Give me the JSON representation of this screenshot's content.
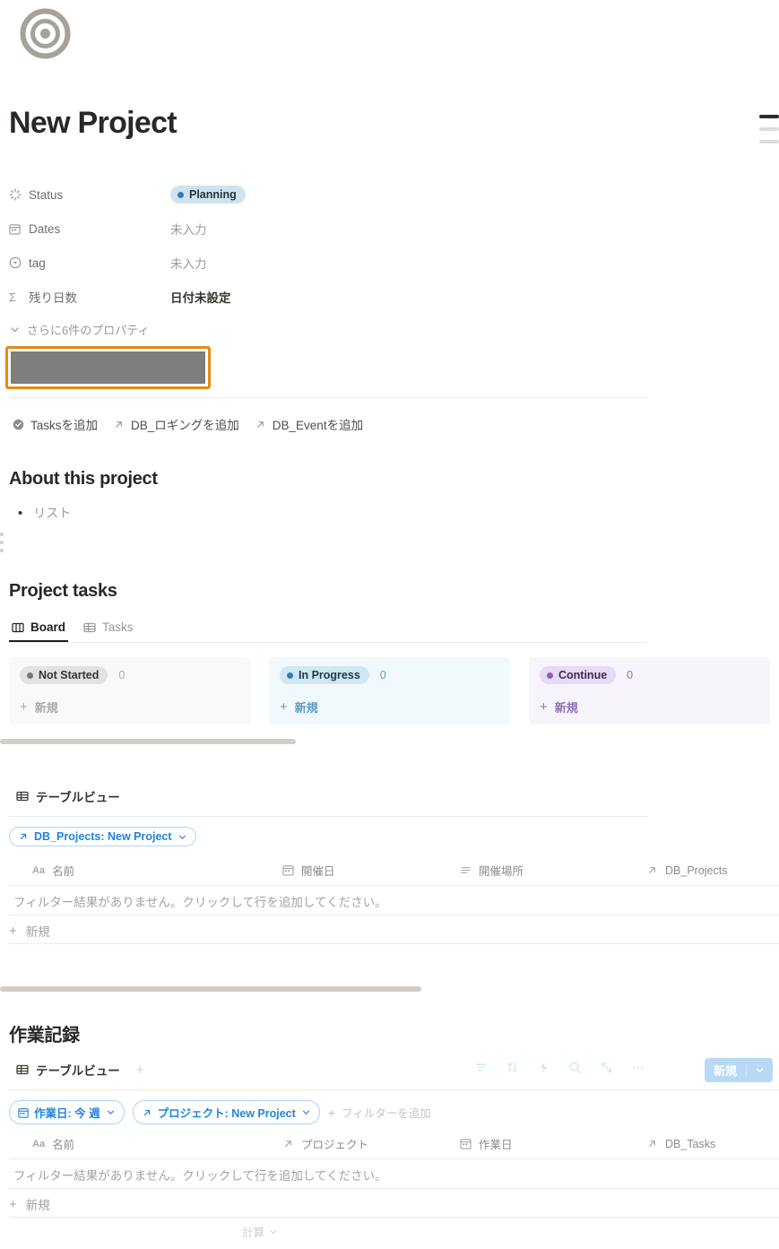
{
  "header": {
    "icon": "target-icon",
    "title": "New Project"
  },
  "properties": {
    "rows": [
      {
        "icon": "spinner-icon",
        "label": "Status",
        "value": "Planning",
        "type": "status-pill"
      },
      {
        "icon": "calendar-icon",
        "label": "Dates",
        "value": "未入力",
        "type": "empty"
      },
      {
        "icon": "select-icon",
        "label": "tag",
        "value": "未入力",
        "type": "empty"
      },
      {
        "icon": "sigma-icon",
        "label": "残り日数",
        "value": "日付未設定",
        "type": "formula"
      }
    ],
    "more_label": "さらに6件のプロパティ",
    "status_pill_bg": "#cfe3ef",
    "status_pill_dot": "#3a7ca8"
  },
  "redacted_block": {
    "highlight_color": "#e08c13",
    "fill_color": "#7e7e7e"
  },
  "add_buttons": [
    {
      "icon": "check-circle-icon",
      "label": "Tasksを追加"
    },
    {
      "icon": "arrow-up-right-icon",
      "label": "DB_ロギングを追加"
    },
    {
      "icon": "arrow-up-right-icon",
      "label": "DB_Eventを追加"
    }
  ],
  "about": {
    "heading": "About this project",
    "bullet": "リスト"
  },
  "project_tasks": {
    "heading": "Project tasks",
    "tabs": [
      {
        "label": "Board",
        "icon": "board-icon",
        "active": true
      },
      {
        "label": "Tasks",
        "icon": "table-icon",
        "active": false
      }
    ],
    "columns": [
      {
        "label": "Not Started",
        "count": "0",
        "new_label": "新規",
        "accent": "#7a7874"
      },
      {
        "label": "In Progress",
        "count": "0",
        "new_label": "新規",
        "accent": "#2f80b8"
      },
      {
        "label": "Continue",
        "count": "0",
        "new_label": "新規",
        "accent": "#8b5fc0"
      },
      {
        "label": "",
        "count": "",
        "new_label": "",
        "accent": "#be7249"
      }
    ]
  },
  "table_view_1": {
    "view_label": "テーブルビュー",
    "filter_chip": "DB_Projects: New Project",
    "columns": [
      {
        "icon": "title-icon",
        "label": "名前"
      },
      {
        "icon": "calendar-icon",
        "label": "開催日"
      },
      {
        "icon": "text-icon",
        "label": "開催場所"
      },
      {
        "icon": "arrow-up-right-icon",
        "label": "DB_Projects"
      }
    ],
    "empty_message": "フィルター結果がありません。クリックして行を追加してください。",
    "new_row_label": "新規"
  },
  "work_log": {
    "heading": "作業記録",
    "view_label": "テーブルビュー",
    "toolbar_icons": [
      "filter-icon",
      "sort-icon",
      "automation-icon",
      "search-icon",
      "expand-icon",
      "more-icon"
    ],
    "new_button_label": "新規",
    "filter_chips": [
      {
        "icon": "calendar-icon",
        "label": "作業日: 今 週"
      },
      {
        "icon": "arrow-up-right-icon",
        "label": "プロジェクト: New Project"
      }
    ],
    "add_filter_label": "フィルターを追加",
    "columns": [
      {
        "icon": "title-icon",
        "label": "名前"
      },
      {
        "icon": "arrow-up-right-icon",
        "label": "プロジェクト"
      },
      {
        "icon": "calendar-icon",
        "label": "作業日"
      },
      {
        "icon": "arrow-up-right-icon",
        "label": "DB_Tasks"
      }
    ],
    "empty_message": "フィルター結果がありません。クリックして行を追加してください。",
    "new_row_label": "新規",
    "calculate_label": "計算"
  }
}
